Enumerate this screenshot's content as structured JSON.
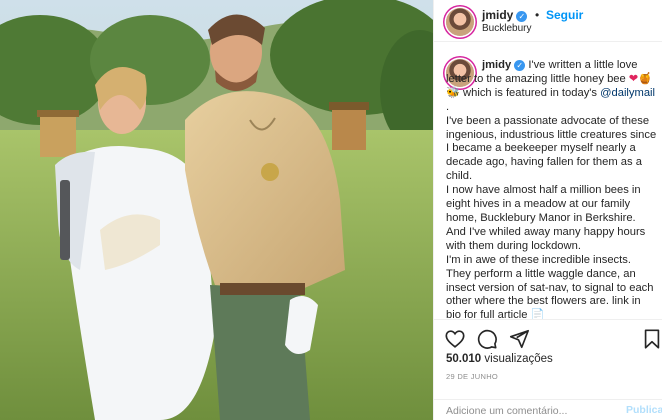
{
  "post": {
    "username": "jmidy",
    "dot": "•",
    "follow_label": "Seguir",
    "location": "Bucklebury"
  },
  "caption": {
    "username": "jmidy",
    "line_intro": " I've written a little love letter to the amazing little honey bee ",
    "line_emoji_text": " which is featured in today's ",
    "mention": "@dailymail",
    "mention_end": " .",
    "para1": "I've been a passionate advocate of these ingenious, industrious little creatures since I became a beekeeper myself nearly a decade ago, having fallen for them as a child.",
    "para2": "I now have almost half a million bees in eight hives in a meadow at our family home, Bucklebury Manor in Berkshire. And I've whiled away many happy hours with them during lockdown.",
    "para3": "I'm in awe of these incredible insects. They perform a little waggle dance, an insect version of sat-nav, to signal to each other where the best flowers are. link in bio for full article "
  },
  "actions": {
    "like_icon": "heart-outline",
    "comment_icon": "speech-bubble",
    "share_icon": "paper-plane",
    "save_icon": "bookmark",
    "views_count": "50.010",
    "views_label": "visualizações",
    "date": "29 DE JUNHO"
  },
  "comment": {
    "placeholder": "Adicione um comentário...",
    "publish_label": "Publicar"
  },
  "colors": {
    "link_blue": "#0095f6",
    "mention_blue": "#00376b",
    "verified_blue": "#3897f0",
    "text": "#262626",
    "muted": "#8e8e8e"
  }
}
